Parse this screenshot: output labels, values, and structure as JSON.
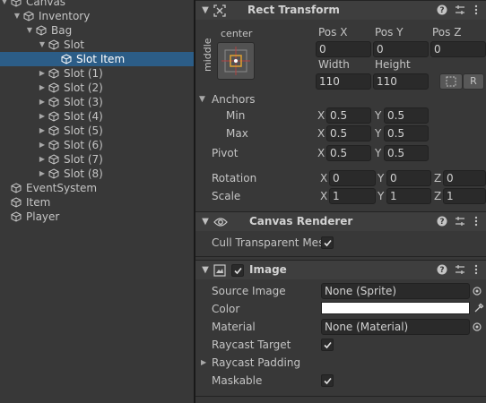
{
  "hierarchy": {
    "canvas": "Canvas",
    "inventory": "Inventory",
    "bag": "Bag",
    "slot": "Slot",
    "slot_item": "Slot Item",
    "slots": [
      "Slot (1)",
      "Slot (2)",
      "Slot (3)",
      "Slot (4)",
      "Slot (5)",
      "Slot (6)",
      "Slot (7)",
      "Slot (8)"
    ],
    "event_system": "EventSystem",
    "item": "Item",
    "player": "Player"
  },
  "rect_transform": {
    "title": "Rect Transform",
    "anchor_preset_h": "center",
    "anchor_preset_v": "middle",
    "pos_x_label": "Pos X",
    "pos_y_label": "Pos Y",
    "pos_z_label": "Pos Z",
    "pos_x": "0",
    "pos_y": "0",
    "pos_z": "0",
    "width_label": "Width",
    "height_label": "Height",
    "width": "110",
    "height": "110",
    "raw_button": "R",
    "anchors_label": "Anchors",
    "min_label": "Min",
    "max_label": "Max",
    "anchor_min_x": "0.5",
    "anchor_min_y": "0.5",
    "anchor_max_x": "0.5",
    "anchor_max_y": "0.5",
    "pivot_label": "Pivot",
    "pivot_x": "0.5",
    "pivot_y": "0.5",
    "rotation_label": "Rotation",
    "rotation_x": "0",
    "rotation_y": "0",
    "rotation_z": "0",
    "scale_label": "Scale",
    "scale_x": "1",
    "scale_y": "1",
    "scale_z": "1",
    "axis_x": "X",
    "axis_y": "Y",
    "axis_z": "Z"
  },
  "canvas_renderer": {
    "title": "Canvas Renderer",
    "cull_label": "Cull Transparent Mes",
    "cull_checked": true
  },
  "image": {
    "title": "Image",
    "enabled": true,
    "source_image_label": "Source Image",
    "source_image_value": "None (Sprite)",
    "color_label": "Color",
    "color_value": "#ffffff",
    "material_label": "Material",
    "material_value": "None (Material)",
    "raycast_target_label": "Raycast Target",
    "raycast_target_checked": true,
    "raycast_padding_label": "Raycast Padding",
    "maskable_label": "Maskable",
    "maskable_checked": true
  },
  "header_icons": {
    "help": "?",
    "presets": "⇄",
    "more": "⋮"
  },
  "colors": {
    "selection": "#2c5d87",
    "panel_bg": "#383838",
    "field_bg": "#2a2a2a"
  }
}
